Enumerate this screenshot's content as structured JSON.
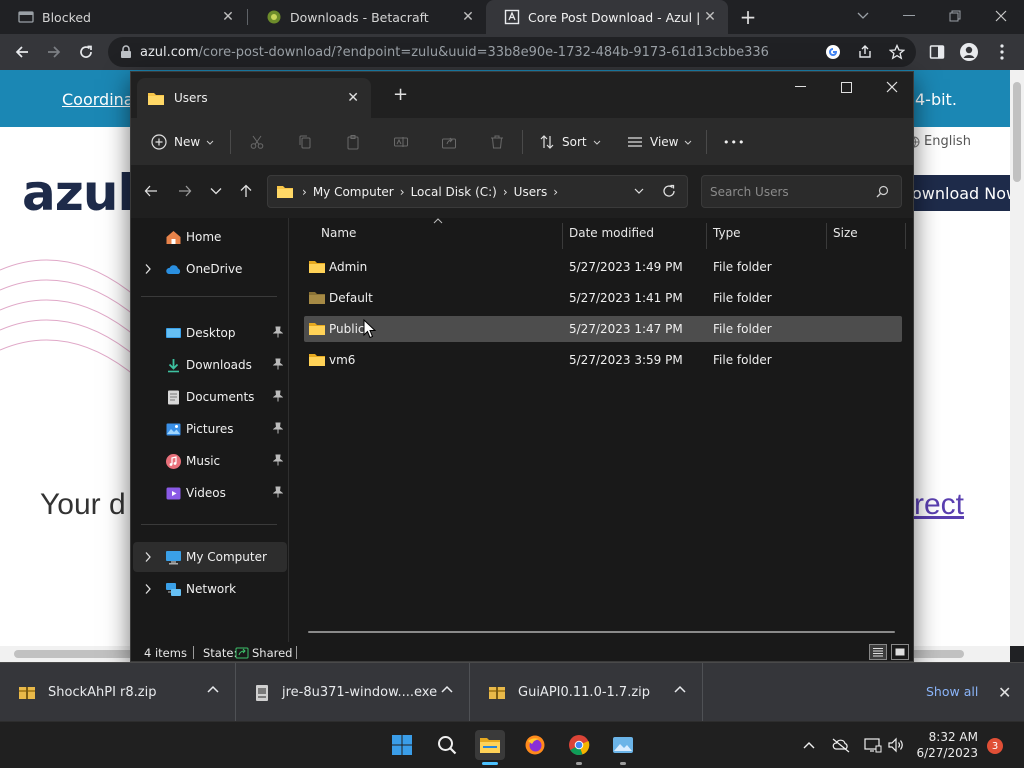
{
  "browser": {
    "tabs": [
      {
        "title": "Blocked",
        "favicon": "blocked-favicon"
      },
      {
        "title": "Downloads - Betacraft",
        "favicon": "betacraft-favicon"
      },
      {
        "title": "Core Post Download - Azul | Better",
        "favicon": "azul-favicon",
        "active": true
      }
    ],
    "new_tab": "+",
    "omnibox": {
      "url_host": "azul.com",
      "url_rest": "/core-post-download/?endpoint=zulu&uuid=33b8e90e-1732-484b-9173-61d13cbbe336"
    }
  },
  "webpage": {
    "banner_left": "Coordinat",
    "banner_right": "4-bit.",
    "language": "English",
    "logo": "azul",
    "download_button": "ownload Now",
    "headline": "Your d",
    "link_text": "rect",
    "colors": {
      "banner": "#1b87b4",
      "logo": "#1e2b4a",
      "link": "#5a3fb0"
    }
  },
  "explorer": {
    "tab_title": "Users",
    "commands": {
      "new": "New",
      "sort": "Sort",
      "view": "View",
      "more": "•••"
    },
    "breadcrumb": [
      "My Computer",
      "Local Disk (C:)",
      "Users"
    ],
    "search_placeholder": "Search Users",
    "nav": {
      "home": "Home",
      "onedrive": "OneDrive",
      "pinned": [
        "Desktop",
        "Downloads",
        "Documents",
        "Pictures",
        "Music",
        "Videos"
      ],
      "my_computer": "My Computer",
      "network": "Network"
    },
    "columns": {
      "name": "Name",
      "date": "Date modified",
      "type": "Type",
      "size": "Size"
    },
    "files": [
      {
        "name": "Admin",
        "date": "5/27/2023 1:49 PM",
        "type": "File folder",
        "size": ""
      },
      {
        "name": "Default",
        "date": "5/27/2023 1:41 PM",
        "type": "File folder",
        "size": ""
      },
      {
        "name": "Public",
        "date": "5/27/2023 1:47 PM",
        "type": "File folder",
        "size": ""
      },
      {
        "name": "vm6",
        "date": "5/27/2023 3:59 PM",
        "type": "File folder",
        "size": ""
      }
    ],
    "status": {
      "count": "4 items",
      "state_label": "State:",
      "state_value": "Shared"
    }
  },
  "downloads": {
    "items": [
      {
        "name": "ShockAhPI r8.zip",
        "icon": "zip-icon"
      },
      {
        "name": "jre-8u371-window....exe",
        "icon": "exe-icon"
      },
      {
        "name": "GuiAPI0.11.0-1.7.zip",
        "icon": "zip-icon"
      }
    ],
    "show_all": "Show all"
  },
  "taskbar": {
    "time": "8:32 AM",
    "date": "6/27/2023",
    "notification_count": "3"
  }
}
